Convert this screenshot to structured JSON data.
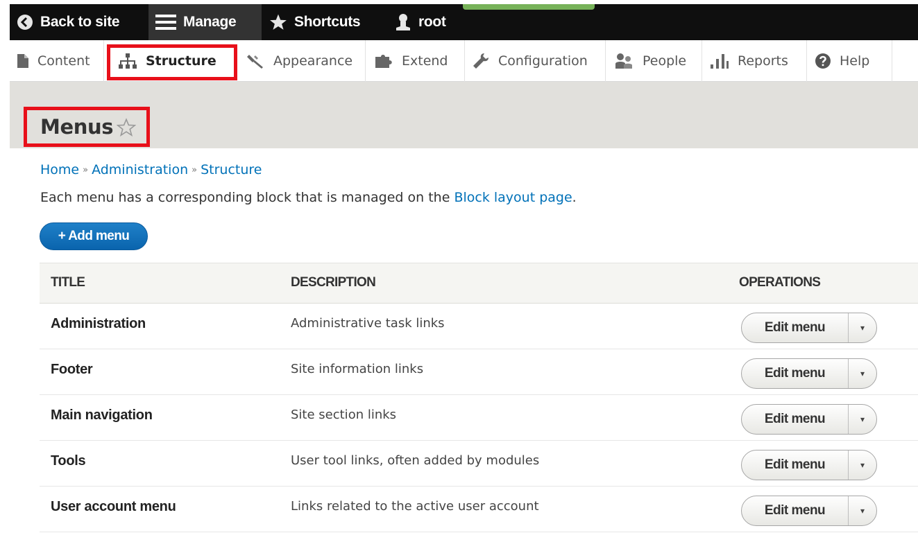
{
  "toolbar": {
    "back_label": "Back to site",
    "manage_label": "Manage",
    "shortcuts_label": "Shortcuts",
    "user_label": "root"
  },
  "tray": {
    "items": [
      {
        "label": "Content",
        "icon": "document-icon"
      },
      {
        "label": "Structure",
        "icon": "sitemap-icon"
      },
      {
        "label": "Appearance",
        "icon": "paintbrush-icon"
      },
      {
        "label": "Extend",
        "icon": "puzzle-icon"
      },
      {
        "label": "Configuration",
        "icon": "wrench-icon"
      },
      {
        "label": "People",
        "icon": "people-icon"
      },
      {
        "label": "Reports",
        "icon": "bar-chart-icon"
      },
      {
        "label": "Help",
        "icon": "question-icon"
      }
    ]
  },
  "page": {
    "title": "Menus"
  },
  "breadcrumb": {
    "home": "Home",
    "sep": "»",
    "administration": "Administration",
    "structure": "Structure"
  },
  "help": {
    "prefix": "Each menu has a corresponding block that is managed on the ",
    "link": "Block layout page",
    "suffix": "."
  },
  "actions": {
    "add_menu": "+ Add menu"
  },
  "table": {
    "headers": {
      "title": "TITLE",
      "description": "DESCRIPTION",
      "operations": "OPERATIONS"
    },
    "rows": [
      {
        "title": "Administration",
        "description": "Administrative task links",
        "op": "Edit menu"
      },
      {
        "title": "Footer",
        "description": "Site information links",
        "op": "Edit menu"
      },
      {
        "title": "Main navigation",
        "description": "Site section links",
        "op": "Edit menu"
      },
      {
        "title": "Tools",
        "description": "User tool links, often added by modules",
        "op": "Edit menu"
      },
      {
        "title": "User account menu",
        "description": "Links related to the active user account",
        "op": "Edit menu"
      }
    ]
  },
  "colors": {
    "accent_blue": "#0071b8",
    "highlight_red": "#e8101a",
    "toolbar_bg": "#0f0f0f"
  }
}
